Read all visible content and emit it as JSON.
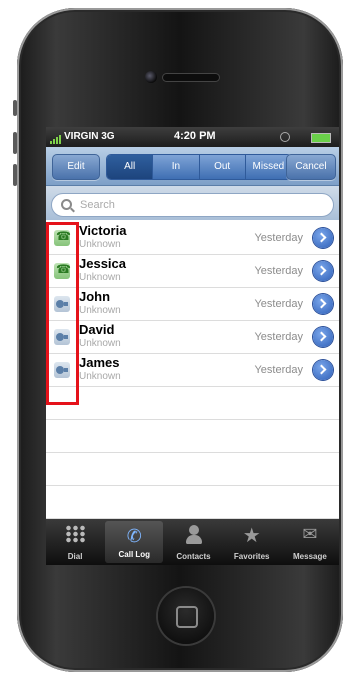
{
  "status": {
    "carrier": "VIRGIN 3G",
    "time": "4:20 PM"
  },
  "toolbar": {
    "edit_label": "Edit",
    "cancel_label": "Cancel",
    "filters": [
      "All",
      "In",
      "Out",
      "Missed"
    ],
    "active_filter": "All"
  },
  "search": {
    "placeholder": "Search"
  },
  "calls": [
    {
      "name": "Victoria",
      "label": "Unknown",
      "when": "Yesterday",
      "type": "phone-icon"
    },
    {
      "name": "Jessica",
      "label": "Unknown",
      "when": "Yesterday",
      "type": "phone-icon"
    },
    {
      "name": "John",
      "label": "Unknown",
      "when": "Yesterday",
      "type": "video-call-icon"
    },
    {
      "name": "David",
      "label": "Unknown",
      "when": "Yesterday",
      "type": "video-call-icon"
    },
    {
      "name": "James",
      "label": "Unknown",
      "when": "Yesterday",
      "type": "video-call-icon"
    }
  ],
  "tabs": [
    {
      "label": "Dial",
      "icon": "keypad-icon"
    },
    {
      "label": "Call Log",
      "icon": "call-log-icon",
      "active": true
    },
    {
      "label": "Contacts",
      "icon": "contacts-icon"
    },
    {
      "label": "Favorites",
      "icon": "star-icon"
    },
    {
      "label": "Message",
      "icon": "envelope-icon"
    }
  ],
  "colors": {
    "accent": "#3f6fb3",
    "highlight": "#e5121a",
    "disclosure": "#2e5fb8"
  }
}
